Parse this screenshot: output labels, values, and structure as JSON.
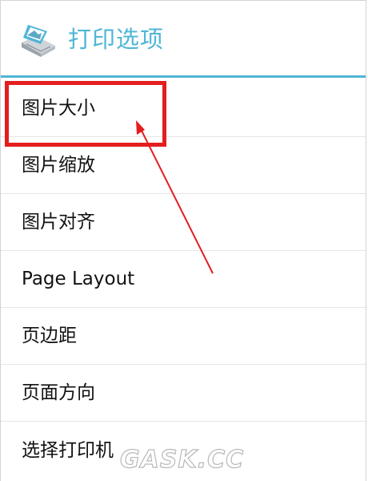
{
  "header": {
    "title": "打印选项",
    "icon": "printer-icon",
    "accent_color": "#4fb6d6"
  },
  "menu": {
    "items": [
      {
        "label": "图片大小",
        "name": "menu-item-image-size"
      },
      {
        "label": "图片缩放",
        "name": "menu-item-image-scale"
      },
      {
        "label": "图片对齐",
        "name": "menu-item-image-align"
      },
      {
        "label": "Page Layout",
        "name": "menu-item-page-layout"
      },
      {
        "label": "页边距",
        "name": "menu-item-page-margins"
      },
      {
        "label": "页面方向",
        "name": "menu-item-page-orientation"
      },
      {
        "label": "选择打印机",
        "name": "menu-item-select-printer"
      }
    ]
  },
  "annotation": {
    "color": "#e41e1e",
    "highlighted_item": "图片大小"
  },
  "watermark": {
    "text": "GASK.CC"
  }
}
